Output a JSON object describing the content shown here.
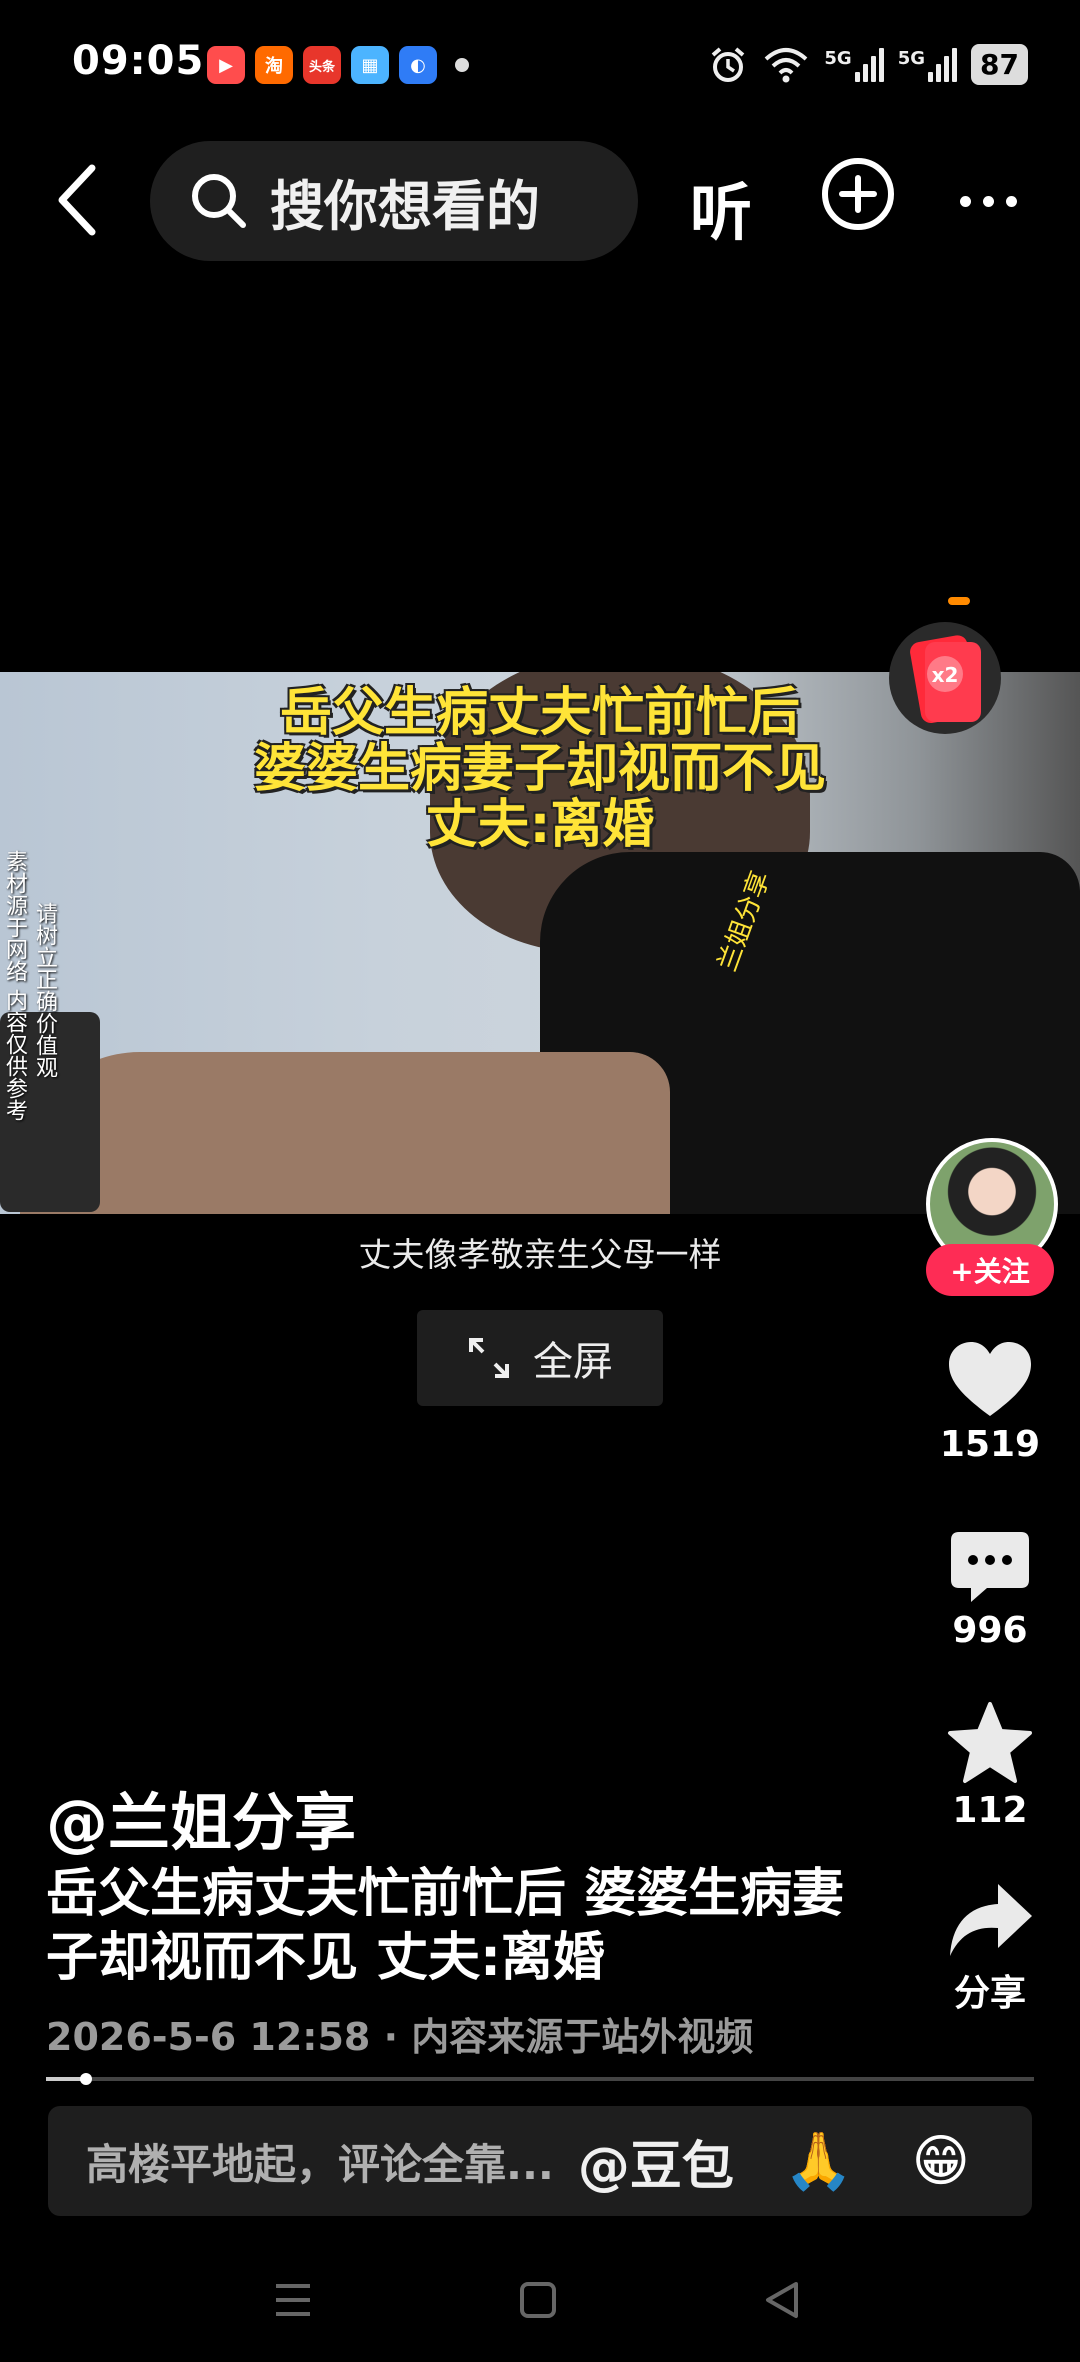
{
  "status": {
    "time": "09:05",
    "apps": [
      {
        "icon": "video-app-icon",
        "color": "#ff4d4d",
        "glyph": "▶"
      },
      {
        "icon": "taobao-icon",
        "color": "#ff6a00",
        "glyph": "淘"
      },
      {
        "icon": "toutiao-icon",
        "color": "#e8362b",
        "glyph": "头条"
      },
      {
        "icon": "photo-app-icon",
        "color": "#4cb4ff",
        "glyph": "▦"
      },
      {
        "icon": "blue-app-icon",
        "color": "#2f7cf6",
        "glyph": "◐"
      }
    ],
    "network_1": "5G",
    "network_2": "5G",
    "battery": "87"
  },
  "nav": {
    "search_placeholder": "搜你想看的",
    "listen_label": "听"
  },
  "video": {
    "caption_lines": [
      "岳父生病丈夫忙前忙后",
      "婆婆生病妻子却视而不见",
      "丈夫:离婚"
    ],
    "side_text_1": "素材源于网络 内容仅供参考",
    "side_text_2": "请树立正确价值观",
    "watermark": "兰姐分享",
    "subtitle": "丈夫像孝敬亲生父母一样",
    "fullscreen_label": "全屏"
  },
  "redpacket": {
    "label": "x2"
  },
  "rail": {
    "follow_label": "+关注",
    "likes": "1519",
    "comments": "996",
    "favorites": "112",
    "share_label": "分享"
  },
  "post": {
    "author": "@兰姐分享",
    "description": "岳父生病丈夫忙前忙后 婆婆生病妻子却视而不见 丈夫:离婚",
    "meta": "2026-5-6 12:58 · 内容来源于站外视频",
    "progress": 0.04
  },
  "comment_bar": {
    "placeholder": "高楼平地起，评论全靠...",
    "mention": "@豆包",
    "emoji_1": "🙏",
    "emoji_2": "😁"
  },
  "colors": {
    "accent": "#fe2c55",
    "caption_yellow": "#ffe438"
  }
}
